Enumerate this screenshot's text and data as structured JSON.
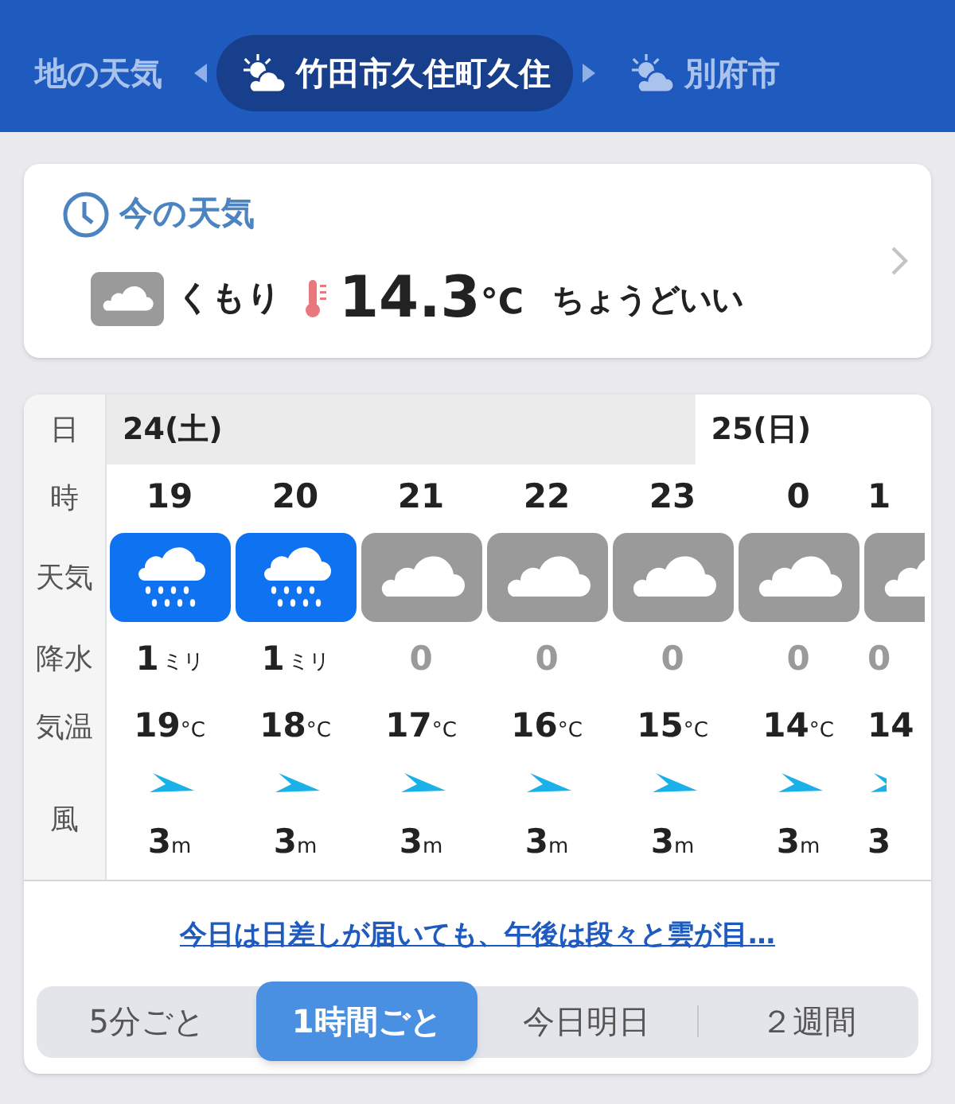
{
  "header": {
    "locations": [
      {
        "label": "地の天気",
        "selected": false,
        "kind": "plain"
      },
      {
        "label": "竹田市久住町久住",
        "selected": true,
        "kind": "weather"
      },
      {
        "label": "別府市",
        "selected": false,
        "kind": "weather"
      }
    ]
  },
  "current": {
    "title": "今の天気",
    "kind": "cloudy",
    "condition": "くもり",
    "temperature": "14.3",
    "unit": "°C",
    "feeling": "ちょうどいい"
  },
  "forecast": {
    "row_labels": [
      "日",
      "時",
      "天気",
      "降水",
      "気温",
      "風"
    ],
    "dates": [
      {
        "label": "24(土)",
        "hours": [
          {
            "hour": "19",
            "kind": "rain",
            "precip": "1",
            "precip_unit": "ミリ",
            "temp": "19",
            "temp_unit": "°C",
            "wind": "3",
            "wind_unit": "m"
          },
          {
            "hour": "20",
            "kind": "rain",
            "precip": "1",
            "precip_unit": "ミリ",
            "temp": "18",
            "temp_unit": "°C",
            "wind": "3",
            "wind_unit": "m"
          },
          {
            "hour": "21",
            "kind": "cloudy",
            "precip": "0",
            "temp": "17",
            "temp_unit": "°C",
            "wind": "3",
            "wind_unit": "m"
          },
          {
            "hour": "22",
            "kind": "cloudy",
            "precip": "0",
            "temp": "16",
            "temp_unit": "°C",
            "wind": "3",
            "wind_unit": "m"
          },
          {
            "hour": "23",
            "kind": "cloudy",
            "precip": "0",
            "temp": "15",
            "temp_unit": "°C",
            "wind": "3",
            "wind_unit": "m"
          }
        ]
      },
      {
        "label": "25(日)",
        "hours": [
          {
            "hour": "0",
            "kind": "cloudy",
            "precip": "0",
            "temp": "14",
            "temp_unit": "°C",
            "wind": "3",
            "wind_unit": "m"
          },
          {
            "hour": "1",
            "kind": "cloudy",
            "precip": "0",
            "temp": "14",
            "wind": "3"
          }
        ]
      }
    ],
    "summary_link": "今日は日差しが届いても、午後は段々と雲が目…"
  },
  "tabs": [
    {
      "label": "5分ごと",
      "selected": false
    },
    {
      "label": "1時間ごと",
      "selected": true
    },
    {
      "label": "今日明日",
      "selected": false
    },
    {
      "label": "２週間",
      "selected": false
    }
  ]
}
